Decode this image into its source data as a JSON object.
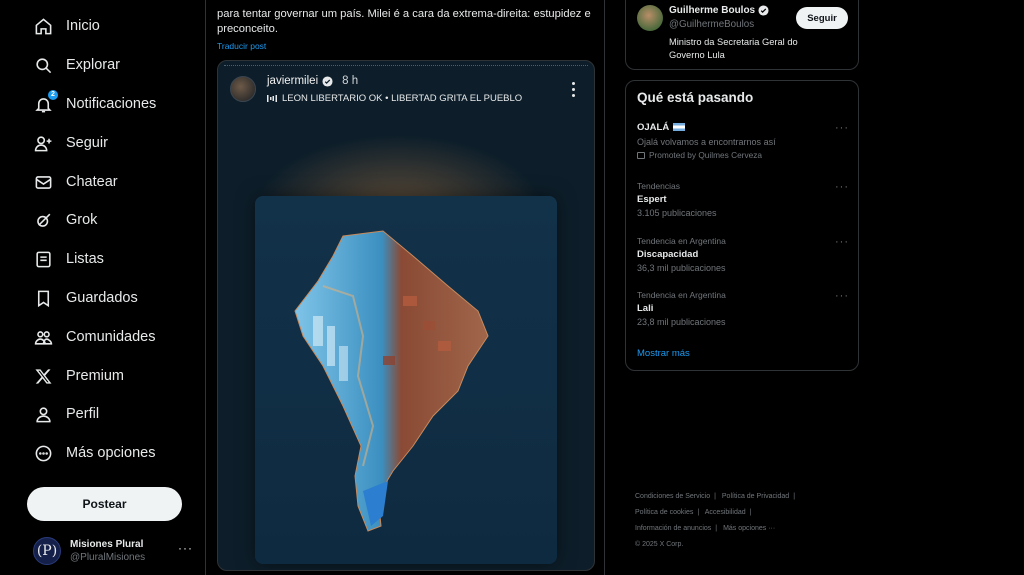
{
  "nav": {
    "items": [
      {
        "label": "Inicio",
        "icon": "home-icon"
      },
      {
        "label": "Explorar",
        "icon": "search-icon"
      },
      {
        "label": "Notificaciones",
        "icon": "bell-icon",
        "badge": "2"
      },
      {
        "label": "Seguir",
        "icon": "follow-icon"
      },
      {
        "label": "Chatear",
        "icon": "mail-icon"
      },
      {
        "label": "Grok",
        "icon": "grok-icon"
      },
      {
        "label": "Listas",
        "icon": "list-icon"
      },
      {
        "label": "Guardados",
        "icon": "bookmark-icon"
      },
      {
        "label": "Comunidades",
        "icon": "communities-icon"
      },
      {
        "label": "Premium",
        "icon": "x-logo-icon"
      },
      {
        "label": "Perfil",
        "icon": "profile-icon"
      },
      {
        "label": "Más opciones",
        "icon": "more-circle-icon"
      }
    ],
    "post_button": "Postear"
  },
  "account": {
    "avatar_letter": "(P)",
    "name": "Misiones Plural",
    "handle": "@PluralMisiones",
    "more": "···"
  },
  "tweet": {
    "text": "para tentar governar um país. Milei é a cara da extrema-direita: estupidez e preconceito.",
    "translate": "Traducir post",
    "media": {
      "username": "javiermilei",
      "time": "8 h",
      "music": "LEON LIBERTARIO OK • LIBERTAD GRITA EL PUEBLO"
    }
  },
  "who_to_follow": {
    "name": "Guilherme Boulos",
    "handle": "@GuilhermeBoulos",
    "bio": "Ministro da Secretaria Geral do Governo Lula",
    "follow_label": "Seguir"
  },
  "trends": {
    "title": "Qué está pasando",
    "items": [
      {
        "name": "OJALÁ",
        "sub": "Ojalá volvamos a encontrarnos así",
        "promo": "Promoted by Quilmes Cerveza"
      },
      {
        "context": "Tendencias",
        "name": "Espert",
        "sub": "3.105 publicaciones"
      },
      {
        "context": "Tendencia en Argentina",
        "name": "Discapacidad",
        "sub": "36,3 mil publicaciones"
      },
      {
        "context": "Tendencia en Argentina",
        "name": "Lali",
        "sub": "23,8 mil publicaciones"
      }
    ],
    "show_more": "Mostrar más"
  },
  "footer": {
    "links": [
      "Condiciones de Servicio",
      "Política de Privacidad",
      "Política de cookies",
      "Accesibilidad",
      "Información de anuncios",
      "Más opciones ···"
    ],
    "copyright": "© 2025 X Corp."
  },
  "colors": {
    "accent": "#1d9bf0",
    "background": "#000000",
    "border": "#2f3336",
    "text_secondary": "#71767b"
  }
}
